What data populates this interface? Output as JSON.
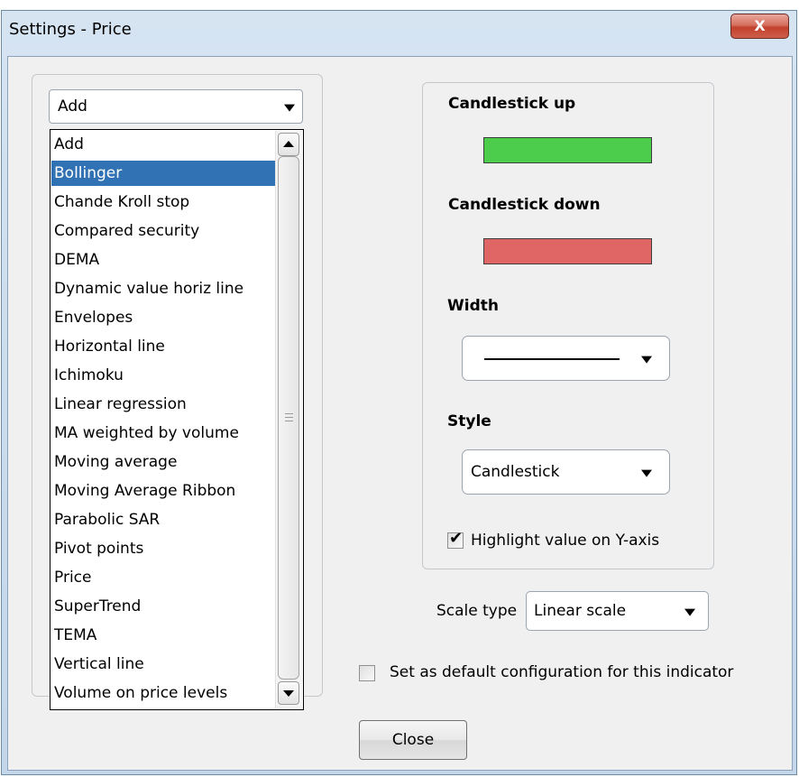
{
  "window": {
    "title": "Settings - Price",
    "close_glyph": "X"
  },
  "indicator_select": {
    "value": "Add",
    "options": [
      "Add",
      "Bollinger",
      "Chande Kroll stop",
      "Compared security",
      "DEMA",
      "Dynamic value horiz line",
      "Envelopes",
      "Horizontal line",
      "Ichimoku",
      "Linear regression",
      "MA weighted by volume",
      "Moving average",
      "Moving Average Ribbon",
      "Parabolic SAR",
      "Pivot points",
      "Price",
      "SuperTrend",
      "TEMA",
      "Vertical line",
      "Volume on price levels"
    ],
    "highlighted": "Bollinger"
  },
  "candle_up": {
    "label": "Candlestick up",
    "color": "#4ccd4c"
  },
  "candle_down": {
    "label": "Candlestick down",
    "color": "#e06666"
  },
  "width": {
    "label": "Width"
  },
  "style": {
    "label": "Style",
    "value": "Candlestick"
  },
  "highlight_y": {
    "label": "Highlight value on Y-axis",
    "checked": true
  },
  "scale": {
    "label": "Scale type",
    "value": "Linear scale"
  },
  "default_config": {
    "label": "Set as default configuration for this indicator",
    "checked": false
  },
  "close_button": {
    "label": "Close"
  }
}
